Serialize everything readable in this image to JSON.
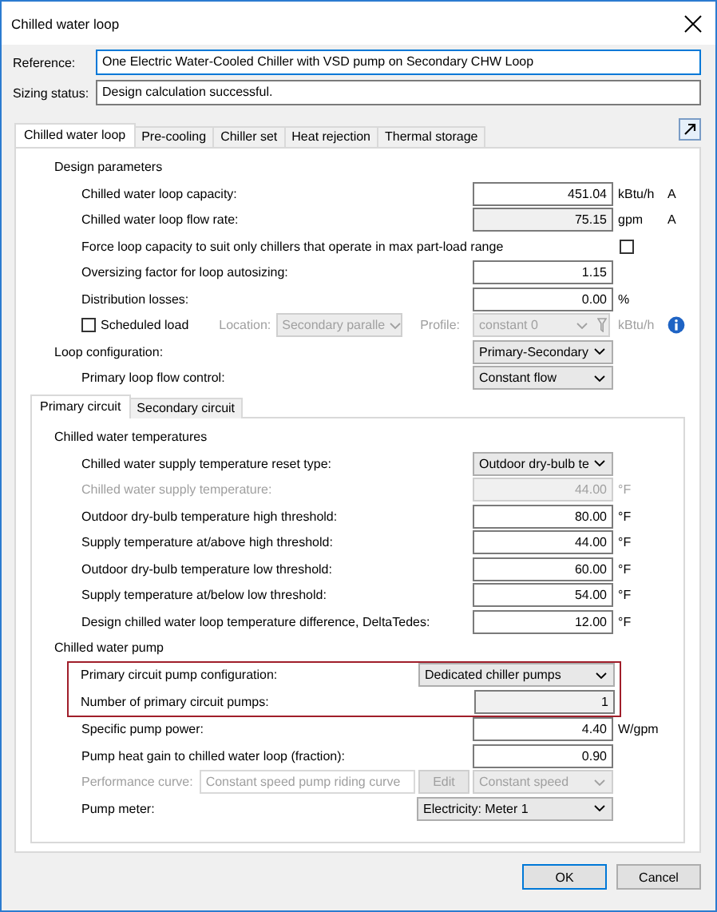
{
  "window": {
    "title": "Chilled water loop"
  },
  "reference": {
    "label": "Reference:",
    "value": "One Electric Water-Cooled Chiller with VSD pump on Secondary CHW Loop",
    "focused": true
  },
  "sizing_status": {
    "label": "Sizing status:",
    "value": "Design calculation successful.",
    "focused": false
  },
  "tabs": [
    {
      "label": "Chilled water loop",
      "selected": true
    },
    {
      "label": "Pre-cooling",
      "selected": false
    },
    {
      "label": "Chiller set",
      "selected": false
    },
    {
      "label": "Heat rejection",
      "selected": false
    },
    {
      "label": "Thermal storage",
      "selected": false
    }
  ],
  "items": [
    {
      "kind": "group",
      "heading": "Design parameters",
      "children": [
        {
          "kind": "number",
          "label": "Chilled water loop capacity:",
          "value": "451.04",
          "unit": "kBtu/h",
          "flag": "A",
          "readonly": false,
          "disabled": false
        },
        {
          "kind": "number",
          "label": "Chilled water loop flow rate:",
          "value": "75.15",
          "unit": "gpm",
          "flag": "A",
          "readonly": true,
          "disabled": false
        },
        {
          "kind": "checkbox",
          "label": "Force loop capacity to suit only chillers that operate in max part-load range",
          "checked": false
        },
        {
          "kind": "number",
          "label": "Oversizing factor for loop autosizing:",
          "value": "1.15",
          "readonly": false,
          "disabled": false
        },
        {
          "kind": "number",
          "label": "Distribution losses:",
          "value": "0.00",
          "unit": "%",
          "readonly": false,
          "disabled": false
        },
        {
          "kind": "scheduled",
          "label": "Scheduled load",
          "checked": false,
          "location_label": "Location:",
          "location": "Secondary paralle",
          "profile_label": "Profile:",
          "profile": "constant 0",
          "unit": "kBtu/h",
          "disabled": true
        }
      ]
    },
    {
      "kind": "select",
      "label": "Loop configuration:",
      "value": "Primary-Secondary",
      "children": [
        {
          "kind": "select",
          "label": "Primary loop flow control:",
          "value": "Constant flow"
        }
      ]
    }
  ],
  "inner_tabs": [
    {
      "label": "Primary circuit",
      "selected": true
    },
    {
      "label": "Secondary circuit",
      "selected": false
    }
  ],
  "inner_items": [
    {
      "kind": "group",
      "heading": "Chilled water temperatures",
      "children": [
        {
          "kind": "select",
          "label": "Chilled water supply temperature reset type:",
          "value": "Outdoor dry-bulb te"
        },
        {
          "kind": "number",
          "label": "Chilled water supply temperature:",
          "value": "44.00",
          "unit": "°F",
          "disabled": true
        },
        {
          "kind": "number",
          "label": "Outdoor dry-bulb temperature high threshold:",
          "value": "80.00",
          "unit": "°F",
          "readonly": false,
          "disabled": false
        },
        {
          "kind": "number",
          "label": "Supply temperature at/above high threshold:",
          "value": "44.00",
          "unit": "°F",
          "readonly": false,
          "disabled": false
        },
        {
          "kind": "number",
          "label": "Outdoor dry-bulb temperature low threshold:",
          "value": "60.00",
          "unit": "°F",
          "readonly": false,
          "disabled": false
        },
        {
          "kind": "number",
          "label": "Supply temperature at/below low threshold:",
          "value": "54.00",
          "unit": "°F",
          "readonly": false,
          "disabled": false
        },
        {
          "kind": "number",
          "label": "Design chilled water loop temperature difference, DeltaTedes:",
          "value": "12.00",
          "unit": "°F",
          "readonly": false,
          "disabled": false
        }
      ]
    },
    {
      "kind": "group",
      "heading": "Chilled water pump",
      "children": [
        {
          "kind": "highlight",
          "children": [
            {
              "kind": "select",
              "label": "Primary circuit pump configuration:",
              "value": "Dedicated chiller pumps",
              "wide": true
            },
            {
              "kind": "number",
              "label": "Number of primary circuit pumps:",
              "value": "1",
              "readonly": true,
              "disabled": false
            }
          ]
        },
        {
          "kind": "number",
          "label": "Specific pump power:",
          "value": "4.40",
          "unit": "W/gpm",
          "readonly": false,
          "disabled": false
        },
        {
          "kind": "number",
          "label": "Pump heat gain to chilled water loop (fraction):",
          "value": "0.90",
          "readonly": false,
          "disabled": false
        },
        {
          "kind": "curve",
          "label": "Performance curve:",
          "value": "Constant speed pump riding curve",
          "button": "Edit",
          "mode": "Constant speed",
          "disabled": true
        },
        {
          "kind": "select",
          "label": "Pump meter:",
          "value": "Electricity: Meter 1",
          "wide": true
        }
      ]
    }
  ],
  "buttons": [
    {
      "label": "OK",
      "default": true
    },
    {
      "label": "Cancel",
      "default": false
    }
  ]
}
